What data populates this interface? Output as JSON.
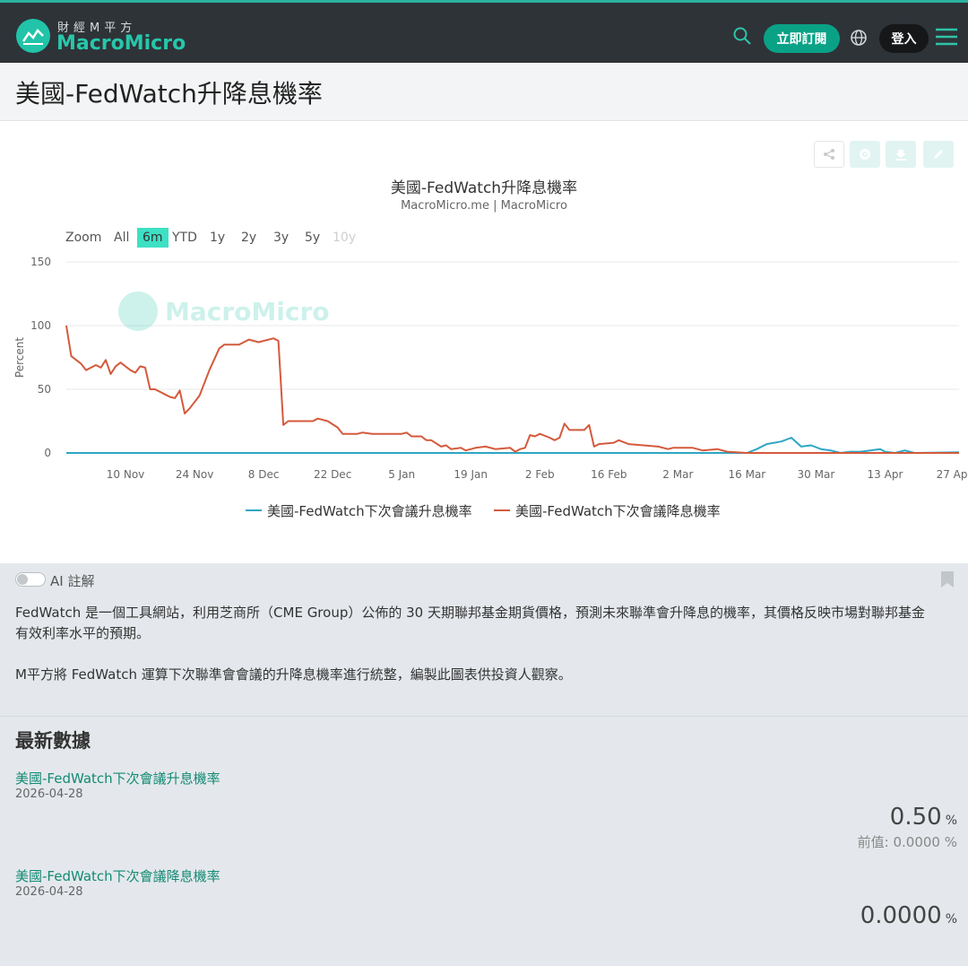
{
  "nav": {
    "logo_cn": "財經M平方",
    "logo_en": "MacroMicro",
    "subscribe_label": "立即訂閱",
    "login_label": "登入"
  },
  "page": {
    "title": "美國-FedWatch升降息機率"
  },
  "toolbar": {
    "icons": [
      "share-icon",
      "gear-icon",
      "download-icon",
      "edit-icon"
    ]
  },
  "chart": {
    "zoom_label": "Zoom",
    "zoom_options": [
      "All",
      "6m",
      "YTD",
      "1y",
      "2y",
      "3y",
      "5y",
      "10y"
    ],
    "zoom_selected": "6m",
    "zoom_disabled": [
      "10y"
    ],
    "watermark": "MacroMicro"
  },
  "chart_data": {
    "type": "line",
    "title": "美國-FedWatch升降息機率",
    "subtitle": "MacroMicro.me | MacroMicro",
    "ylabel": "Percent",
    "ylim": [
      0,
      150
    ],
    "yticks": [
      0,
      50,
      100,
      150
    ],
    "x_tick_labels": [
      "10 Nov",
      "24 Nov",
      "8 Dec",
      "22 Dec",
      "5 Jan",
      "19 Jan",
      "2 Feb",
      "16 Feb",
      "2 Mar",
      "16 Mar",
      "30 Mar",
      "13 Apr",
      "27 Apr"
    ],
    "grid": true,
    "legend_position": "bottom",
    "colors": {
      "hike": "#2ea6c4",
      "cut": "#d45a3c"
    },
    "series": [
      {
        "name": "美國-FedWatch下次會議升息機率",
        "points": [
          [
            "Oct 29",
            0
          ],
          [
            "Mar 16",
            0
          ],
          [
            "Mar 18",
            3
          ],
          [
            "Mar 20",
            7
          ],
          [
            "Mar 23",
            9
          ],
          [
            "Mar 25",
            12
          ],
          [
            "Mar 27",
            5
          ],
          [
            "Mar 29",
            6
          ],
          [
            "Mar 31",
            3
          ],
          [
            "Apr 2",
            2
          ],
          [
            "Apr 4",
            0
          ],
          [
            "Apr 6",
            1
          ],
          [
            "Apr 8",
            1
          ],
          [
            "Apr 10",
            2
          ],
          [
            "Apr 12",
            3
          ],
          [
            "Apr 13",
            1
          ],
          [
            "Apr 15",
            0
          ],
          [
            "Apr 17",
            2
          ],
          [
            "Apr 19",
            0
          ],
          [
            "Apr 28",
            0.5
          ]
        ]
      },
      {
        "name": "美國-FedWatch下次會議降息機率",
        "points": [
          [
            "Oct 29",
            100
          ],
          [
            "Oct 30",
            76
          ],
          [
            "Nov 1",
            70
          ],
          [
            "Nov 2",
            65
          ],
          [
            "Nov 4",
            69
          ],
          [
            "Nov 5",
            67
          ],
          [
            "Nov 6",
            73
          ],
          [
            "Nov 7",
            62
          ],
          [
            "Nov 8",
            68
          ],
          [
            "Nov 9",
            71
          ],
          [
            "Nov 11",
            65
          ],
          [
            "Nov 12",
            63
          ],
          [
            "Nov 13",
            68
          ],
          [
            "Nov 14",
            67
          ],
          [
            "Nov 15",
            50
          ],
          [
            "Nov 16",
            50
          ],
          [
            "Nov 18",
            46
          ],
          [
            "Nov 19",
            44
          ],
          [
            "Nov 20",
            43
          ],
          [
            "Nov 21",
            49
          ],
          [
            "Nov 22",
            31
          ],
          [
            "Nov 23",
            35
          ],
          [
            "Nov 25",
            45
          ],
          [
            "Nov 27",
            65
          ],
          [
            "Nov 29",
            82
          ],
          [
            "Nov 30",
            85
          ],
          [
            "Dec 3",
            85
          ],
          [
            "Dec 4",
            87
          ],
          [
            "Dec 5",
            89
          ],
          [
            "Dec 7",
            87
          ],
          [
            "Dec 10",
            90
          ],
          [
            "Dec 11",
            88
          ],
          [
            "Dec 12",
            22
          ],
          [
            "Dec 13",
            25
          ],
          [
            "Dec 18",
            25
          ],
          [
            "Dec 19",
            27
          ],
          [
            "Dec 21",
            25
          ],
          [
            "Dec 23",
            20
          ],
          [
            "Dec 24",
            15
          ],
          [
            "Dec 27",
            15
          ],
          [
            "Dec 28",
            16
          ],
          [
            "Dec 30",
            15
          ],
          [
            "Jan 5",
            15
          ],
          [
            "Jan 6",
            16
          ],
          [
            "Jan 7",
            13
          ],
          [
            "Jan 9",
            13
          ],
          [
            "Jan 10",
            10
          ],
          [
            "Jan 11",
            10
          ],
          [
            "Jan 13",
            5
          ],
          [
            "Jan 14",
            6
          ],
          [
            "Jan 15",
            3
          ],
          [
            "Jan 17",
            4
          ],
          [
            "Jan 18",
            2
          ],
          [
            "Jan 20",
            4
          ],
          [
            "Jan 22",
            5
          ],
          [
            "Jan 24",
            3
          ],
          [
            "Jan 27",
            4
          ],
          [
            "Jan 28",
            1
          ],
          [
            "Jan 29",
            3
          ],
          [
            "Jan 30",
            4
          ],
          [
            "Jan 31",
            14
          ],
          [
            "Feb 1",
            13
          ],
          [
            "Feb 2",
            15
          ],
          [
            "Feb 4",
            12
          ],
          [
            "Feb 5",
            10
          ],
          [
            "Feb 6",
            12
          ],
          [
            "Feb 7",
            23
          ],
          [
            "Feb 8",
            18
          ],
          [
            "Feb 9",
            18
          ],
          [
            "Feb 11",
            18
          ],
          [
            "Feb 12",
            22
          ],
          [
            "Feb 13",
            5
          ],
          [
            "Feb 14",
            7
          ],
          [
            "Feb 17",
            8
          ],
          [
            "Feb 18",
            10
          ],
          [
            "Feb 20",
            7
          ],
          [
            "Feb 23",
            6
          ],
          [
            "Feb 26",
            5
          ],
          [
            "Feb 28",
            3
          ],
          [
            "Mar 1",
            4
          ],
          [
            "Mar 5",
            4
          ],
          [
            "Mar 7",
            2
          ],
          [
            "Mar 10",
            3
          ],
          [
            "Mar 12",
            1
          ],
          [
            "Mar 16",
            0
          ],
          [
            "Apr 28",
            0
          ]
        ]
      }
    ]
  },
  "ai_note": {
    "toggle_label": "AI 註解",
    "paragraph1_line1": "FedWatch 是一個工具網站，利用芝商所（CME Group）公佈的 30 天期聯邦基金期貨價格，預測未來聯準會升降息的機率，其價格反映市場對聯邦基金",
    "paragraph1_line2": "有效利率水平的預期。",
    "paragraph2": "M平方將 FedWatch 運算下次聯準會會議的升降息機率進行統整，編製此圖表供投資人觀察。"
  },
  "latest": {
    "title": "最新數據",
    "items": [
      {
        "name": "美國-FedWatch下次會議升息機率",
        "date": "2026-04-28",
        "value": "0.50",
        "unit": "%",
        "prev": "前值: 0.0000 %"
      },
      {
        "name": "美國-FedWatch下次會議降息機率",
        "date": "2026-04-28",
        "value": "0.0000",
        "unit": "%"
      }
    ]
  }
}
